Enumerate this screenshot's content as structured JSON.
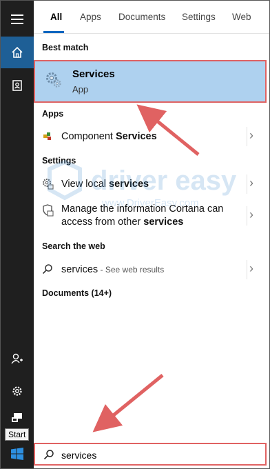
{
  "tabs": [
    {
      "label": "All",
      "active": true
    },
    {
      "label": "Apps",
      "active": false
    },
    {
      "label": "Documents",
      "active": false
    },
    {
      "label": "Settings",
      "active": false
    },
    {
      "label": "Web",
      "active": false
    }
  ],
  "rail": {
    "start_tooltip": "Start",
    "icons": [
      "hamburger-icon",
      "home-icon",
      "notebook-icon",
      "add-user-icon",
      "settings-gear-icon",
      "feedback-icon",
      "windows-logo-icon"
    ]
  },
  "best_match": {
    "heading": "Best match",
    "title": "Services",
    "subtitle": "App"
  },
  "apps_section": {
    "heading": "Apps",
    "item_prefix": "Component ",
    "item_bold": "Services"
  },
  "settings_section": {
    "heading": "Settings",
    "item1_prefix": "View local ",
    "item1_bold": "services",
    "item2_line1": "Manage the information Cortana can",
    "item2_line2_prefix": "access from other ",
    "item2_line2_bold": "services"
  },
  "web_section": {
    "heading": "Search the web",
    "query": "services",
    "suffix": " - See web results"
  },
  "documents_section": {
    "heading": "Documents (14+)"
  },
  "watermark": {
    "brand": "driver easy",
    "url": "www.DriverEasy.com"
  },
  "search": {
    "value": "services"
  },
  "colors": {
    "highlight": "#aed1ef",
    "annotation_red": "#e06262",
    "rail_bg": "#1f1f1f",
    "rail_active": "#1e5f96",
    "accent": "#0b66c0"
  }
}
